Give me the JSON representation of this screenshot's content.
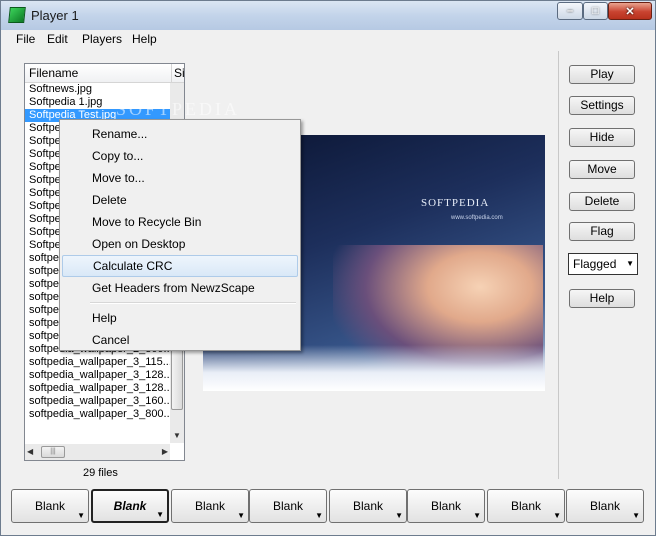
{
  "window": {
    "title": "Player 1"
  },
  "menubar": [
    "File",
    "Edit",
    "Players",
    "Help"
  ],
  "filelist": {
    "columns": [
      "Filename",
      "Si"
    ],
    "rows": [
      "Softnews.jpg",
      "Softpedia 1.jpg",
      "Softpedia Test.jpg",
      "Softpedia_wallpaper.jpg",
      "Softpedia_wallpaper1.jpg",
      "Softpedia_wallpaper2.jpg",
      "Softpedia_wallpaper3.jpg",
      "Softpedia_wallpaper4.jpg",
      "Softpedia_wallpaper5.jpg",
      "Softpedia_wallpaper6.jpg",
      "Softpedia_wallpaper7.jpg",
      "Softpedia_wallpaper8.jpg",
      "Softpedia_wallpaper9.jpg",
      "softpedia_wallpaper_1.jpg",
      "softpedia_wallpaper_1_800.jpg",
      "softpedia_wallpaper_1_1024.jpg",
      "softpedia_wallpaper_1_1152.jpg",
      "softpedia_wallpaper_1_1280.jpg",
      "softpedia_wallpaper_2_1024.jpg",
      "softpedia_wallpaper_2_1600.jpg",
      "softpedia_wallpaper_2_800...",
      "softpedia_wallpaper_3_115...",
      "softpedia_wallpaper_3_128...",
      "softpedia_wallpaper_3_128...",
      "softpedia_wallpaper_3_160...",
      "softpedia_wallpaper_3_800..."
    ],
    "selected_index": 2,
    "file_count": "29 files"
  },
  "context_menu": {
    "group1": [
      "Rename...",
      "Copy to...",
      "Move to...",
      "Delete",
      "Move to Recycle Bin",
      "Open on Desktop",
      "Calculate CRC",
      "Get Headers from NewzScape"
    ],
    "group2": [
      "Help",
      "Cancel"
    ],
    "hover_item": "Calculate CRC"
  },
  "side_buttons": {
    "play": "Play",
    "settings": "Settings",
    "hide": "Hide",
    "move": "Move",
    "delete": "Delete",
    "flag": "Flag",
    "flagged": "Flagged",
    "help": "Help"
  },
  "preview": {
    "logo": "SOFTPEDIA",
    "url": "www.softpedia.com",
    "watermark": "SOFTPEDIA",
    "watermark_url": "www.softpedia.com"
  },
  "bottom_slots": [
    "Blank",
    "Blank",
    "Blank",
    "Blank",
    "Blank",
    "Blank",
    "Blank",
    "Blank"
  ],
  "active_slot_index": 1
}
